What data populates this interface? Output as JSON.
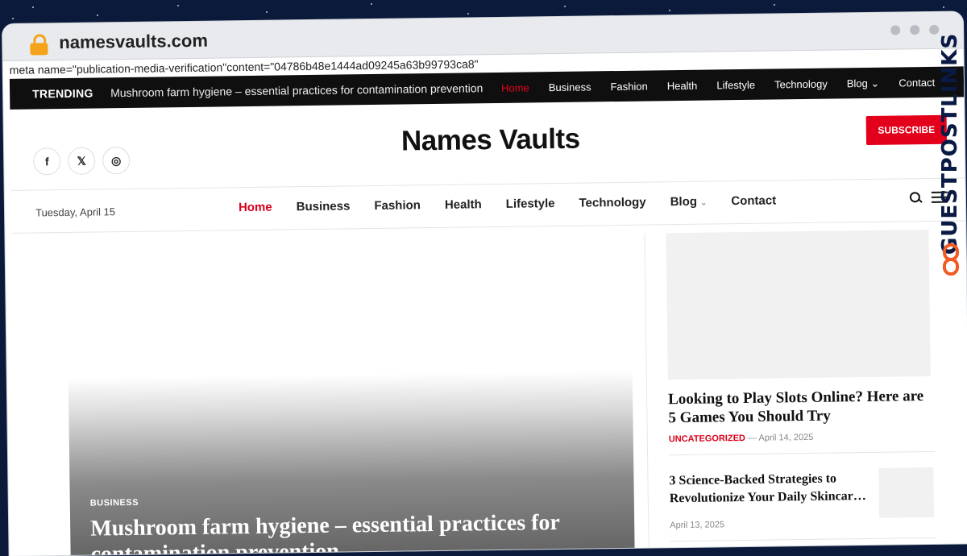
{
  "browser": {
    "url": "namesvaults.com",
    "meta_line": "meta name=\"publication-media-verification\"content=\"04786b48e1444ad09245a63b99793ca8\""
  },
  "topbar": {
    "trending_label": "TRENDING",
    "trending_text": "Mushroom farm hygiene – essential practices for contamination prevention",
    "nav": [
      "Home",
      "Business",
      "Fashion",
      "Health",
      "Lifestyle",
      "Technology",
      "Blog",
      "Contact"
    ]
  },
  "header": {
    "site_name": "Names Vaults",
    "subscribe_label": "SUBSCRIBE",
    "socials": [
      "facebook-icon",
      "x-icon",
      "instagram-icon"
    ]
  },
  "mainnav": {
    "date": "Tuesday, April 15",
    "items": [
      "Home",
      "Business",
      "Fashion",
      "Health",
      "Lifestyle",
      "Technology",
      "Blog",
      "Contact"
    ]
  },
  "hero": {
    "category": "BUSINESS",
    "title": "Mushroom farm hygiene – essential practices for contamination prevention"
  },
  "sidebar": {
    "post1": {
      "title": "Looking to Play Slots Online? Here are 5 Games You Should Try",
      "category": "UNCATEGORIZED",
      "date": "— April 14, 2025"
    },
    "post2": {
      "title": "3 Science-Backed Strategies to Revolutionize Your Daily Skincar…",
      "date": "April 13, 2025"
    }
  },
  "watermark": {
    "text": "GUESTPOSTLINKS"
  },
  "colors": {
    "accent": "#e3001b",
    "topbar_bg": "#0f0f0f",
    "watermark_text": "#0a1a44",
    "watermark_logo": "#f15a24"
  }
}
